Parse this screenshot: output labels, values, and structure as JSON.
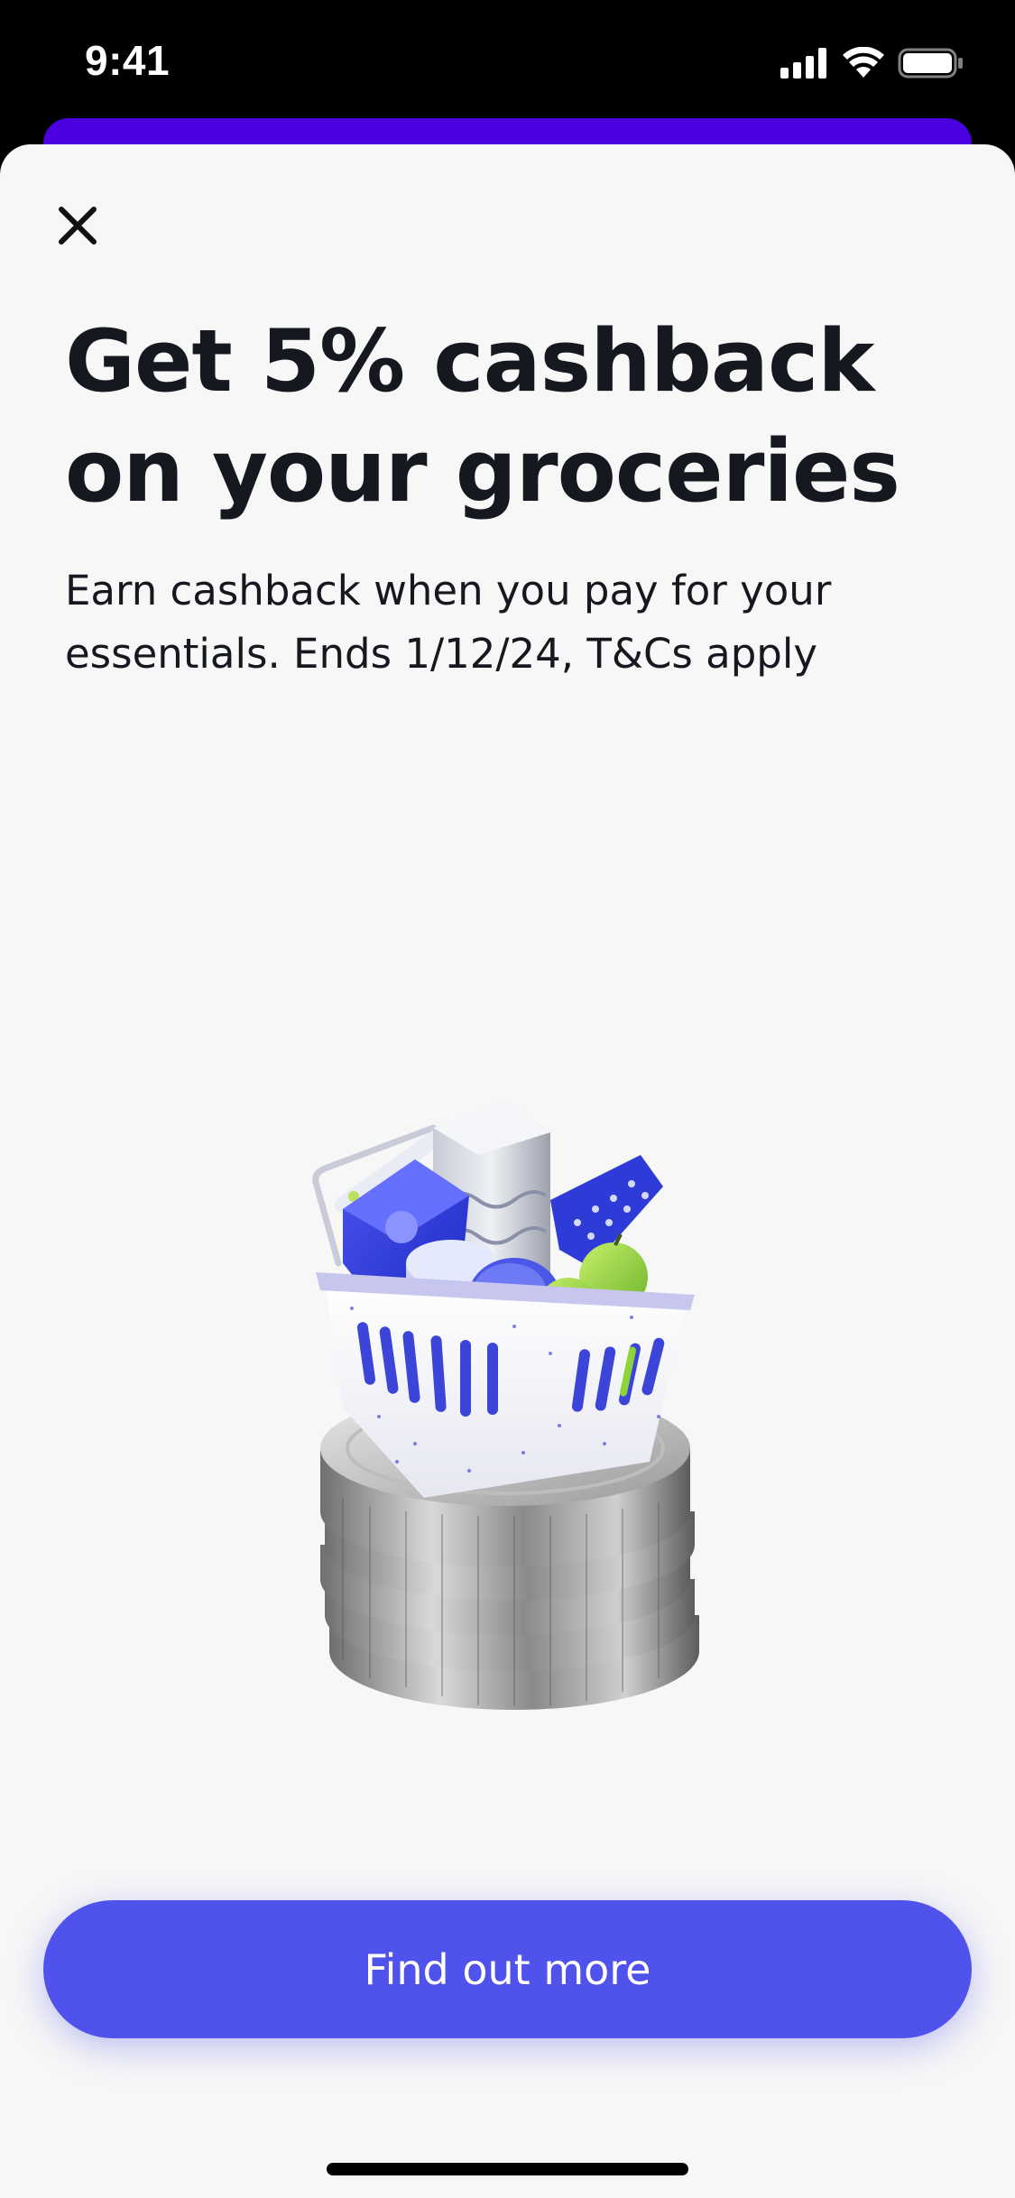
{
  "status_bar": {
    "time": "9:41"
  },
  "promo": {
    "title_line1": "Get 5% cashback",
    "title_line2": "on your groceries",
    "subtitle_line1": "Earn cashback when you pay for your",
    "subtitle_line2": "essentials. Ends 1/12/24, T&Cs apply"
  },
  "cta": {
    "label": "Find out more"
  },
  "icons": {
    "close": "close-icon",
    "illustration": "grocery-basket-on-coins-illustration"
  },
  "colors": {
    "accent": "#5052ec",
    "back_sheet": "#4b00e0",
    "sheet_bg": "#f7f7f7",
    "text": "#16181f"
  }
}
